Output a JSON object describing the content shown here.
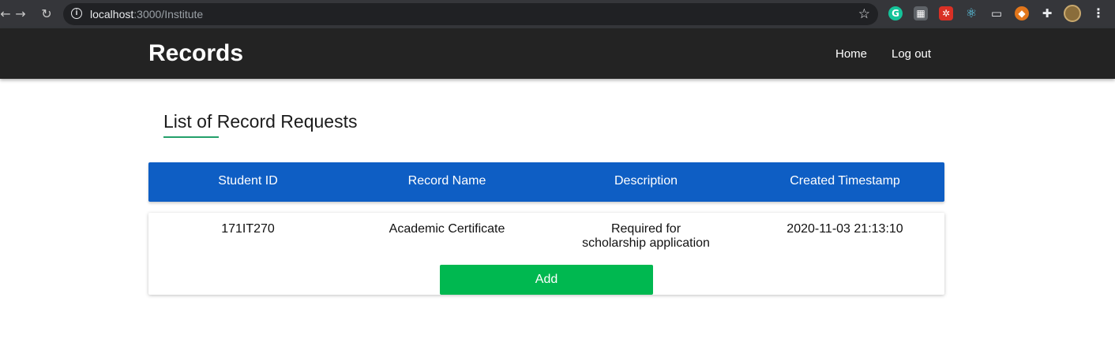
{
  "browser": {
    "url_host": "localhost",
    "url_path": ":3000/Institute",
    "icons": [
      "back-icon",
      "forward-icon",
      "reload-icon",
      "info-icon",
      "star-icon",
      "grammarly-icon",
      "extension-icon",
      "extension-icon",
      "react-devtools-icon",
      "monitor-icon",
      "metamask-icon",
      "puzzle-icon",
      "avatar",
      "menu-icon"
    ]
  },
  "header": {
    "brand": "Records",
    "nav": {
      "home": "Home",
      "logout": "Log out"
    }
  },
  "main": {
    "title": "List of Record Requests",
    "table": {
      "columns": [
        "Student ID",
        "Record Name",
        "Description",
        "Created Timestamp"
      ],
      "rows": [
        {
          "student_id": "171IT270",
          "record_name": "Academic Certificate",
          "description": "Required for scholarship application",
          "created": "2020-11-03 21:13:10",
          "action": "Add"
        }
      ]
    }
  },
  "colors": {
    "header_bg": "#232323",
    "table_header_bg": "#0e5ec4",
    "add_button": "#00b850",
    "title_underline": "#23a06a"
  }
}
